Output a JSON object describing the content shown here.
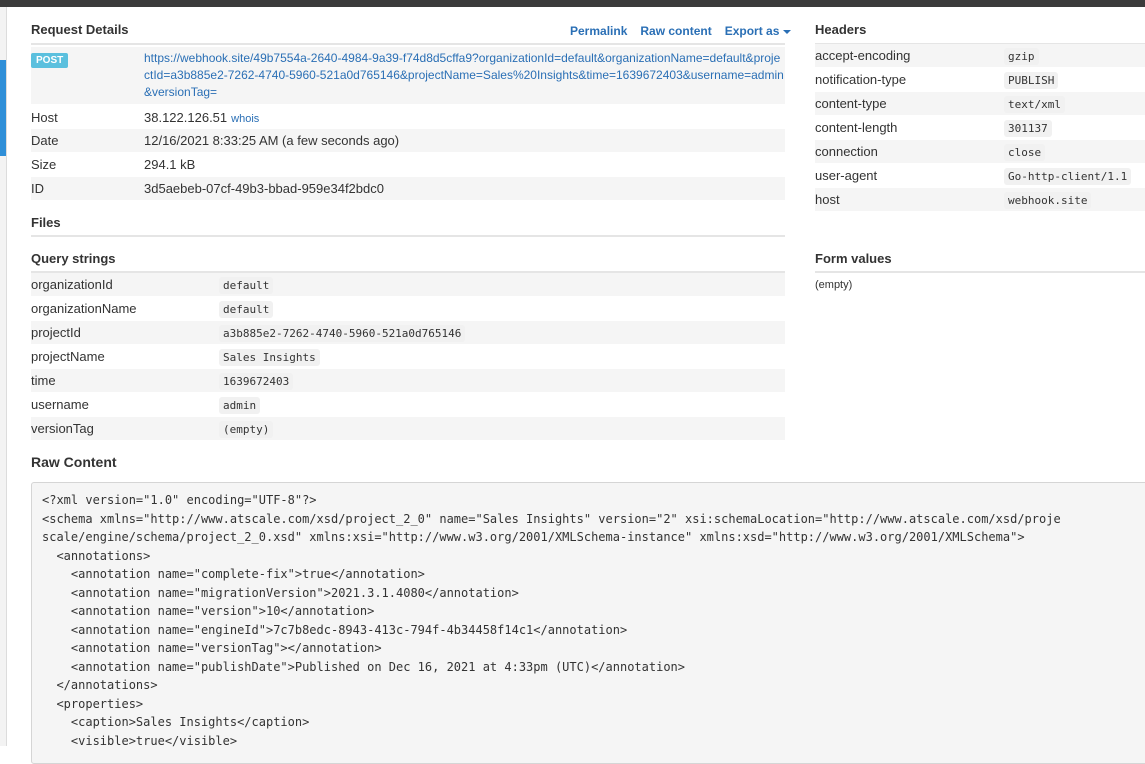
{
  "request_details": {
    "title": "Request Details",
    "actions": {
      "permalink": "Permalink",
      "raw_content": "Raw content",
      "export": "Export as"
    },
    "method": "POST",
    "url": "https://webhook.site/49b7554a-2640-4984-9a39-f74d8d5cffa9?organizationId=default&organizationName=default&projectId=a3b885e2-7262-4740-5960-521a0d765146&projectName=Sales%20Insights&time=1639672403&username=admin&versionTag=",
    "host_label": "Host",
    "host_value": "38.122.126.51",
    "whois": "whois",
    "date_label": "Date",
    "date_value": "12/16/2021 8:33:25 AM (a few seconds ago)",
    "size_label": "Size",
    "size_value": "294.1 kB",
    "id_label": "ID",
    "id_value": "3d5aebeb-07cf-49b3-bbad-959e34f2bdc0"
  },
  "headers": {
    "title": "Headers",
    "items": [
      {
        "key": "accept-encoding",
        "value": "gzip"
      },
      {
        "key": "notification-type",
        "value": "PUBLISH"
      },
      {
        "key": "content-type",
        "value": "text/xml"
      },
      {
        "key": "content-length",
        "value": "301137"
      },
      {
        "key": "connection",
        "value": "close"
      },
      {
        "key": "user-agent",
        "value": "Go-http-client/1.1"
      },
      {
        "key": "host",
        "value": "webhook.site"
      }
    ]
  },
  "files": {
    "title": "Files"
  },
  "query_strings": {
    "title": "Query strings",
    "items": [
      {
        "key": "organizationId",
        "value": "default"
      },
      {
        "key": "organizationName",
        "value": "default"
      },
      {
        "key": "projectId",
        "value": "a3b885e2-7262-4740-5960-521a0d765146"
      },
      {
        "key": "projectName",
        "value": "Sales Insights"
      },
      {
        "key": "time",
        "value": "1639672403"
      },
      {
        "key": "username",
        "value": "admin"
      },
      {
        "key": "versionTag",
        "value": "(empty)"
      }
    ]
  },
  "form_values": {
    "title": "Form values",
    "empty": "(empty)"
  },
  "raw_content": {
    "title": "Raw Content",
    "lines": [
      "<?xml version=\"1.0\" encoding=\"UTF-8\"?>",
      "<schema xmlns=\"http://www.atscale.com/xsd/project_2_0\" name=\"Sales Insights\" version=\"2\" xsi:schemaLocation=\"http://www.atscale.com/xsd/proje",
      "scale/engine/schema/project_2_0.xsd\" xmlns:xsi=\"http://www.w3.org/2001/XMLSchema-instance\" xmlns:xsd=\"http://www.w3.org/2001/XMLSchema\">",
      "  <annotations>",
      "    <annotation name=\"complete-fix\">true</annotation>",
      "    <annotation name=\"migrationVersion\">2021.3.1.4080</annotation>",
      "    <annotation name=\"version\">10</annotation>",
      "    <annotation name=\"engineId\">7c7b8edc-8943-413c-794f-4b34458f14c1</annotation>",
      "    <annotation name=\"versionTag\"></annotation>",
      "    <annotation name=\"publishDate\">Published on Dec 16, 2021 at 4:33pm (UTC)</annotation>",
      "  </annotations>",
      "  <properties>",
      "    <caption>Sales Insights</caption>",
      "    <visible>true</visible>"
    ]
  }
}
